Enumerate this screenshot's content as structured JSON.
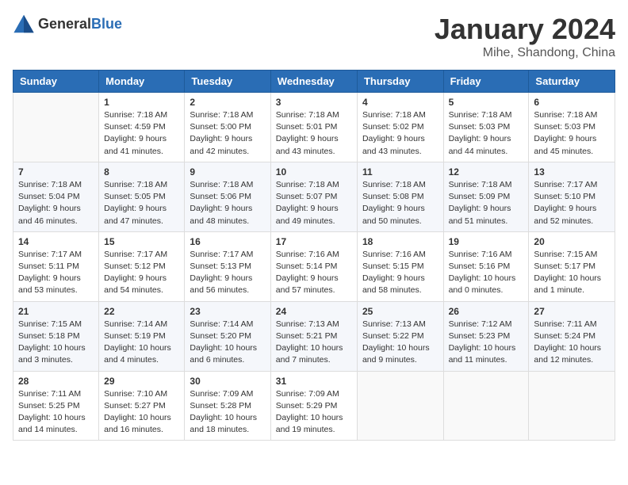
{
  "header": {
    "logo_general": "General",
    "logo_blue": "Blue",
    "month": "January 2024",
    "location": "Mihe, Shandong, China"
  },
  "weekdays": [
    "Sunday",
    "Monday",
    "Tuesday",
    "Wednesday",
    "Thursday",
    "Friday",
    "Saturday"
  ],
  "weeks": [
    [
      {
        "day": "",
        "info": ""
      },
      {
        "day": "1",
        "info": "Sunrise: 7:18 AM\nSunset: 4:59 PM\nDaylight: 9 hours\nand 41 minutes."
      },
      {
        "day": "2",
        "info": "Sunrise: 7:18 AM\nSunset: 5:00 PM\nDaylight: 9 hours\nand 42 minutes."
      },
      {
        "day": "3",
        "info": "Sunrise: 7:18 AM\nSunset: 5:01 PM\nDaylight: 9 hours\nand 43 minutes."
      },
      {
        "day": "4",
        "info": "Sunrise: 7:18 AM\nSunset: 5:02 PM\nDaylight: 9 hours\nand 43 minutes."
      },
      {
        "day": "5",
        "info": "Sunrise: 7:18 AM\nSunset: 5:03 PM\nDaylight: 9 hours\nand 44 minutes."
      },
      {
        "day": "6",
        "info": "Sunrise: 7:18 AM\nSunset: 5:03 PM\nDaylight: 9 hours\nand 45 minutes."
      }
    ],
    [
      {
        "day": "7",
        "info": "Sunrise: 7:18 AM\nSunset: 5:04 PM\nDaylight: 9 hours\nand 46 minutes."
      },
      {
        "day": "8",
        "info": "Sunrise: 7:18 AM\nSunset: 5:05 PM\nDaylight: 9 hours\nand 47 minutes."
      },
      {
        "day": "9",
        "info": "Sunrise: 7:18 AM\nSunset: 5:06 PM\nDaylight: 9 hours\nand 48 minutes."
      },
      {
        "day": "10",
        "info": "Sunrise: 7:18 AM\nSunset: 5:07 PM\nDaylight: 9 hours\nand 49 minutes."
      },
      {
        "day": "11",
        "info": "Sunrise: 7:18 AM\nSunset: 5:08 PM\nDaylight: 9 hours\nand 50 minutes."
      },
      {
        "day": "12",
        "info": "Sunrise: 7:18 AM\nSunset: 5:09 PM\nDaylight: 9 hours\nand 51 minutes."
      },
      {
        "day": "13",
        "info": "Sunrise: 7:17 AM\nSunset: 5:10 PM\nDaylight: 9 hours\nand 52 minutes."
      }
    ],
    [
      {
        "day": "14",
        "info": "Sunrise: 7:17 AM\nSunset: 5:11 PM\nDaylight: 9 hours\nand 53 minutes."
      },
      {
        "day": "15",
        "info": "Sunrise: 7:17 AM\nSunset: 5:12 PM\nDaylight: 9 hours\nand 54 minutes."
      },
      {
        "day": "16",
        "info": "Sunrise: 7:17 AM\nSunset: 5:13 PM\nDaylight: 9 hours\nand 56 minutes."
      },
      {
        "day": "17",
        "info": "Sunrise: 7:16 AM\nSunset: 5:14 PM\nDaylight: 9 hours\nand 57 minutes."
      },
      {
        "day": "18",
        "info": "Sunrise: 7:16 AM\nSunset: 5:15 PM\nDaylight: 9 hours\nand 58 minutes."
      },
      {
        "day": "19",
        "info": "Sunrise: 7:16 AM\nSunset: 5:16 PM\nDaylight: 10 hours\nand 0 minutes."
      },
      {
        "day": "20",
        "info": "Sunrise: 7:15 AM\nSunset: 5:17 PM\nDaylight: 10 hours\nand 1 minute."
      }
    ],
    [
      {
        "day": "21",
        "info": "Sunrise: 7:15 AM\nSunset: 5:18 PM\nDaylight: 10 hours\nand 3 minutes."
      },
      {
        "day": "22",
        "info": "Sunrise: 7:14 AM\nSunset: 5:19 PM\nDaylight: 10 hours\nand 4 minutes."
      },
      {
        "day": "23",
        "info": "Sunrise: 7:14 AM\nSunset: 5:20 PM\nDaylight: 10 hours\nand 6 minutes."
      },
      {
        "day": "24",
        "info": "Sunrise: 7:13 AM\nSunset: 5:21 PM\nDaylight: 10 hours\nand 7 minutes."
      },
      {
        "day": "25",
        "info": "Sunrise: 7:13 AM\nSunset: 5:22 PM\nDaylight: 10 hours\nand 9 minutes."
      },
      {
        "day": "26",
        "info": "Sunrise: 7:12 AM\nSunset: 5:23 PM\nDaylight: 10 hours\nand 11 minutes."
      },
      {
        "day": "27",
        "info": "Sunrise: 7:11 AM\nSunset: 5:24 PM\nDaylight: 10 hours\nand 12 minutes."
      }
    ],
    [
      {
        "day": "28",
        "info": "Sunrise: 7:11 AM\nSunset: 5:25 PM\nDaylight: 10 hours\nand 14 minutes."
      },
      {
        "day": "29",
        "info": "Sunrise: 7:10 AM\nSunset: 5:27 PM\nDaylight: 10 hours\nand 16 minutes."
      },
      {
        "day": "30",
        "info": "Sunrise: 7:09 AM\nSunset: 5:28 PM\nDaylight: 10 hours\nand 18 minutes."
      },
      {
        "day": "31",
        "info": "Sunrise: 7:09 AM\nSunset: 5:29 PM\nDaylight: 10 hours\nand 19 minutes."
      },
      {
        "day": "",
        "info": ""
      },
      {
        "day": "",
        "info": ""
      },
      {
        "day": "",
        "info": ""
      }
    ]
  ]
}
